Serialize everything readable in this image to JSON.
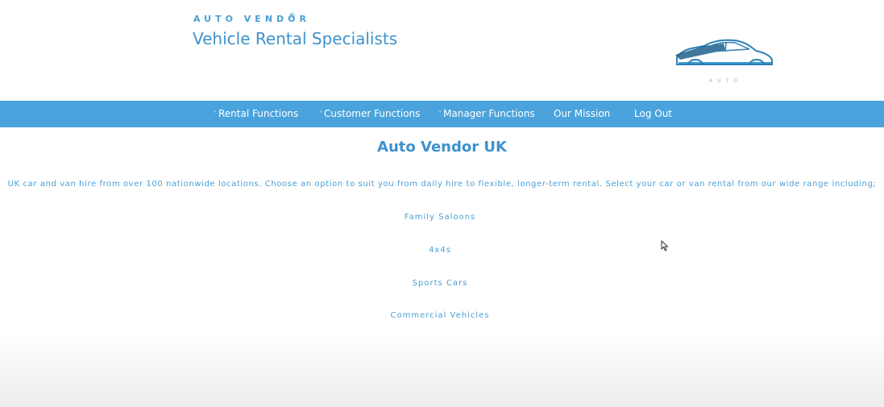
{
  "header": {
    "brand_small": "AUTO VENDOR",
    "brand_registered": "®",
    "title": "Vehicle Rental Specialists",
    "logo_icon": "car-logo-icon",
    "logo_text": "AUTO"
  },
  "nav": {
    "items": [
      {
        "label": "Rental Functions",
        "has_dropdown": true
      },
      {
        "label": "Customer Functions",
        "has_dropdown": true
      },
      {
        "label": "Manager Functions",
        "has_dropdown": true
      },
      {
        "label": "Our Mission",
        "has_dropdown": false
      },
      {
        "label": "Log Out",
        "has_dropdown": false
      }
    ],
    "caret": "˅"
  },
  "main": {
    "title": "Auto Vendor UK",
    "intro": "UK car and van hire from over 100 nationwide locations. Choose an option to suit you from daily hire to flexible, longer-term rental. Select your car or van rental from our wide range including;",
    "range": [
      "Family Saloons",
      "4x4s",
      "Sports Cars",
      "Commercial Vehicles"
    ]
  },
  "colors": {
    "accent": "#4aa3dc",
    "text": "#4a9fd5",
    "title": "#3e92cc"
  }
}
